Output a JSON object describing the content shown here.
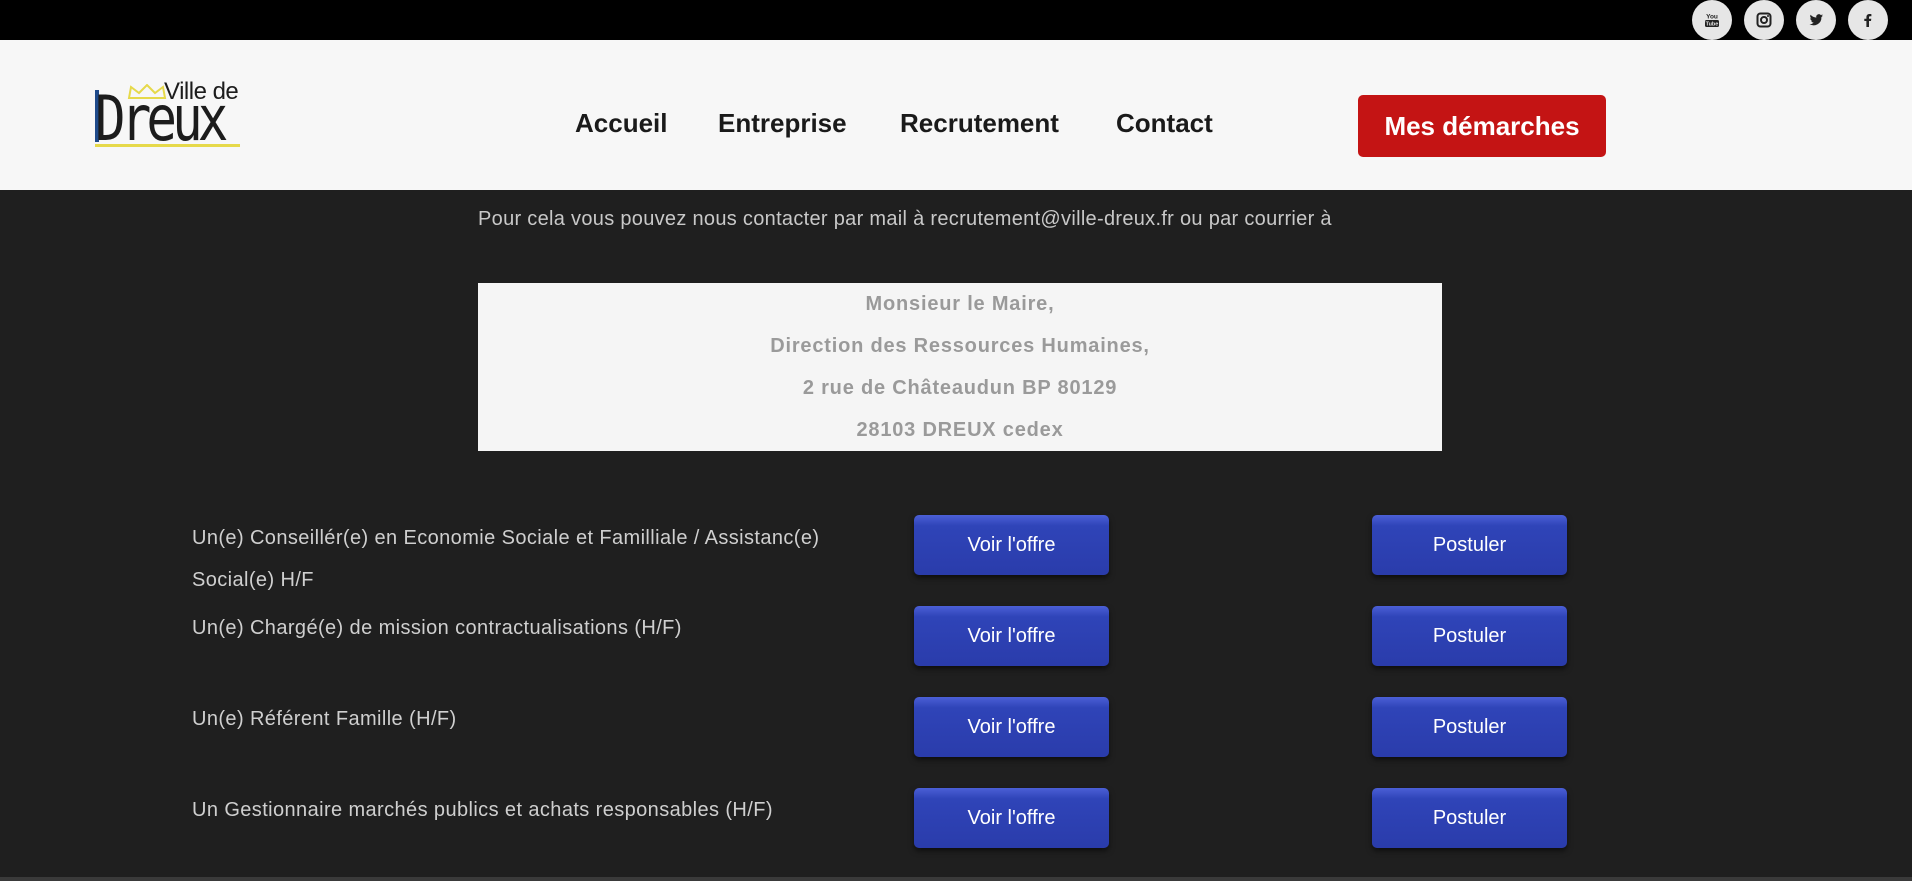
{
  "social": {
    "youtube": {
      "label": "You",
      "sub": "Tube"
    }
  },
  "logo": {
    "small_text": "Ville de",
    "big_text": "Dreux"
  },
  "nav": {
    "items": [
      "Accueil",
      "Entreprise",
      "Recrutement",
      "Contact"
    ],
    "cta": "Mes démarches"
  },
  "intro_text": "Pour cela vous pouvez nous contacter par mail à recrutement@ville-dreux.fr ou par courrier à",
  "address": [
    "Monsieur le Maire,",
    "Direction des Ressources Humaines,",
    "2 rue de Châteaudun BP 80129",
    "28103 DREUX cedex"
  ],
  "buttons": {
    "view": "Voir l'offre",
    "apply": "Postuler"
  },
  "jobs": [
    {
      "title": "Un(e) Conseillér(e) en Economie Sociale et Familliale / Assistanc(e) Social(e) H/F"
    },
    {
      "title": "Un(e) Chargé(e) de mission contractualisations (H/F)"
    },
    {
      "title": "Un(e) Référent Famille (H/F)"
    },
    {
      "title": "Un Gestionnaire marchés publics et achats responsables (H/F)"
    }
  ]
}
